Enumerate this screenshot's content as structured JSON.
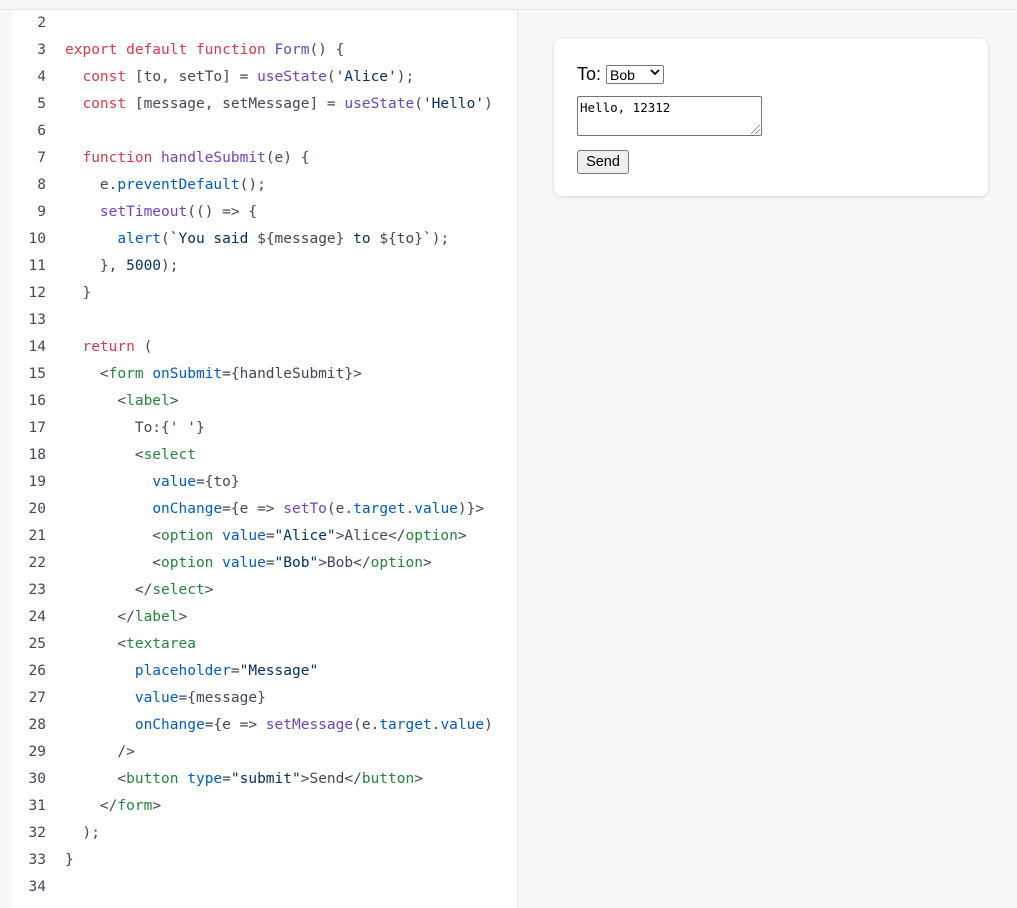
{
  "code": {
    "lines": [
      {
        "n": "2",
        "segs": []
      },
      {
        "n": "3",
        "segs": [
          {
            "c": "kw",
            "t": "export default function "
          },
          {
            "c": "fn",
            "t": "Form"
          },
          {
            "c": "txt",
            "t": "() {"
          }
        ]
      },
      {
        "n": "4",
        "segs": [
          {
            "c": "txt",
            "t": "  "
          },
          {
            "c": "kw",
            "t": "const"
          },
          {
            "c": "txt",
            "t": " [to, setTo] = "
          },
          {
            "c": "fn",
            "t": "useState"
          },
          {
            "c": "txt",
            "t": "("
          },
          {
            "c": "str",
            "t": "'Alice'"
          },
          {
            "c": "txt",
            "t": ");"
          }
        ]
      },
      {
        "n": "5",
        "segs": [
          {
            "c": "txt",
            "t": "  "
          },
          {
            "c": "kw",
            "t": "const"
          },
          {
            "c": "txt",
            "t": " [message, setMessage] = "
          },
          {
            "c": "fn",
            "t": "useState"
          },
          {
            "c": "txt",
            "t": "("
          },
          {
            "c": "str",
            "t": "'Hello'"
          },
          {
            "c": "txt",
            "t": ")"
          }
        ]
      },
      {
        "n": "6",
        "segs": []
      },
      {
        "n": "7",
        "segs": [
          {
            "c": "txt",
            "t": "  "
          },
          {
            "c": "kw",
            "t": "function"
          },
          {
            "c": "txt",
            "t": " "
          },
          {
            "c": "fn",
            "t": "handleSubmit"
          },
          {
            "c": "txt",
            "t": "(e) {"
          }
        ]
      },
      {
        "n": "8",
        "segs": [
          {
            "c": "txt",
            "t": "    e."
          },
          {
            "c": "at",
            "t": "preventDefault"
          },
          {
            "c": "txt",
            "t": "();"
          }
        ]
      },
      {
        "n": "9",
        "segs": [
          {
            "c": "txt",
            "t": "    "
          },
          {
            "c": "fn",
            "t": "setTimeout"
          },
          {
            "c": "txt",
            "t": "(() => {"
          }
        ]
      },
      {
        "n": "10",
        "segs": [
          {
            "c": "txt",
            "t": "      "
          },
          {
            "c": "at",
            "t": "alert"
          },
          {
            "c": "txt",
            "t": "("
          },
          {
            "c": "str",
            "t": "`You said "
          },
          {
            "c": "txt",
            "t": "${message}"
          },
          {
            "c": "str",
            "t": " to "
          },
          {
            "c": "txt",
            "t": "${to}"
          },
          {
            "c": "str",
            "t": "`"
          },
          {
            "c": "txt",
            "t": ");"
          }
        ]
      },
      {
        "n": "11",
        "segs": [
          {
            "c": "txt",
            "t": "    }, "
          },
          {
            "c": "str",
            "t": "5000"
          },
          {
            "c": "txt",
            "t": ");"
          }
        ]
      },
      {
        "n": "12",
        "segs": [
          {
            "c": "txt",
            "t": "  }"
          }
        ]
      },
      {
        "n": "13",
        "segs": []
      },
      {
        "n": "14",
        "segs": [
          {
            "c": "txt",
            "t": "  "
          },
          {
            "c": "kw",
            "t": "return"
          },
          {
            "c": "txt",
            "t": " ("
          }
        ]
      },
      {
        "n": "15",
        "segs": [
          {
            "c": "txt",
            "t": "    <"
          },
          {
            "c": "tag",
            "t": "form"
          },
          {
            "c": "txt",
            "t": " "
          },
          {
            "c": "at",
            "t": "onSubmit"
          },
          {
            "c": "txt",
            "t": "={handleSubmit}>"
          }
        ]
      },
      {
        "n": "16",
        "segs": [
          {
            "c": "txt",
            "t": "      <"
          },
          {
            "c": "tag",
            "t": "label"
          },
          {
            "c": "txt",
            "t": ">"
          }
        ]
      },
      {
        "n": "17",
        "segs": [
          {
            "c": "txt",
            "t": "        To:{' '}"
          }
        ]
      },
      {
        "n": "18",
        "segs": [
          {
            "c": "txt",
            "t": "        <"
          },
          {
            "c": "tag",
            "t": "select"
          }
        ]
      },
      {
        "n": "19",
        "segs": [
          {
            "c": "txt",
            "t": "          "
          },
          {
            "c": "at",
            "t": "value"
          },
          {
            "c": "txt",
            "t": "={to}"
          }
        ]
      },
      {
        "n": "20",
        "segs": [
          {
            "c": "txt",
            "t": "          "
          },
          {
            "c": "at",
            "t": "onChange"
          },
          {
            "c": "txt",
            "t": "={e => "
          },
          {
            "c": "fn",
            "t": "setTo"
          },
          {
            "c": "txt",
            "t": "(e."
          },
          {
            "c": "at",
            "t": "target"
          },
          {
            "c": "txt",
            "t": "."
          },
          {
            "c": "at",
            "t": "value"
          },
          {
            "c": "txt",
            "t": ")}>"
          }
        ]
      },
      {
        "n": "21",
        "segs": [
          {
            "c": "txt",
            "t": "          <"
          },
          {
            "c": "tag",
            "t": "option"
          },
          {
            "c": "txt",
            "t": " "
          },
          {
            "c": "at",
            "t": "value"
          },
          {
            "c": "txt",
            "t": "="
          },
          {
            "c": "str",
            "t": "\"Alice\""
          },
          {
            "c": "txt",
            "t": ">Alice</"
          },
          {
            "c": "tag",
            "t": "option"
          },
          {
            "c": "txt",
            "t": ">"
          }
        ]
      },
      {
        "n": "22",
        "segs": [
          {
            "c": "txt",
            "t": "          <"
          },
          {
            "c": "tag",
            "t": "option"
          },
          {
            "c": "txt",
            "t": " "
          },
          {
            "c": "at",
            "t": "value"
          },
          {
            "c": "txt",
            "t": "="
          },
          {
            "c": "str",
            "t": "\"Bob\""
          },
          {
            "c": "txt",
            "t": ">Bob</"
          },
          {
            "c": "tag",
            "t": "option"
          },
          {
            "c": "txt",
            "t": ">"
          }
        ]
      },
      {
        "n": "23",
        "segs": [
          {
            "c": "txt",
            "t": "        </"
          },
          {
            "c": "tag",
            "t": "select"
          },
          {
            "c": "txt",
            "t": ">"
          }
        ]
      },
      {
        "n": "24",
        "segs": [
          {
            "c": "txt",
            "t": "      </"
          },
          {
            "c": "tag",
            "t": "label"
          },
          {
            "c": "txt",
            "t": ">"
          }
        ]
      },
      {
        "n": "25",
        "segs": [
          {
            "c": "txt",
            "t": "      <"
          },
          {
            "c": "tag",
            "t": "textarea"
          }
        ]
      },
      {
        "n": "26",
        "segs": [
          {
            "c": "txt",
            "t": "        "
          },
          {
            "c": "at",
            "t": "placeholder"
          },
          {
            "c": "txt",
            "t": "="
          },
          {
            "c": "str",
            "t": "\"Message\""
          }
        ]
      },
      {
        "n": "27",
        "segs": [
          {
            "c": "txt",
            "t": "        "
          },
          {
            "c": "at",
            "t": "value"
          },
          {
            "c": "txt",
            "t": "={message}"
          }
        ]
      },
      {
        "n": "28",
        "segs": [
          {
            "c": "txt",
            "t": "        "
          },
          {
            "c": "at",
            "t": "onChange"
          },
          {
            "c": "txt",
            "t": "={e => "
          },
          {
            "c": "fn",
            "t": "setMessage"
          },
          {
            "c": "txt",
            "t": "(e."
          },
          {
            "c": "at",
            "t": "target"
          },
          {
            "c": "txt",
            "t": "."
          },
          {
            "c": "at",
            "t": "value"
          },
          {
            "c": "txt",
            "t": ")"
          }
        ]
      },
      {
        "n": "29",
        "segs": [
          {
            "c": "txt",
            "t": "      />"
          }
        ]
      },
      {
        "n": "30",
        "segs": [
          {
            "c": "txt",
            "t": "      <"
          },
          {
            "c": "tag",
            "t": "button"
          },
          {
            "c": "txt",
            "t": " "
          },
          {
            "c": "at",
            "t": "type"
          },
          {
            "c": "txt",
            "t": "="
          },
          {
            "c": "str",
            "t": "\"submit\""
          },
          {
            "c": "txt",
            "t": ">Send</"
          },
          {
            "c": "tag",
            "t": "button"
          },
          {
            "c": "txt",
            "t": ">"
          }
        ]
      },
      {
        "n": "31",
        "segs": [
          {
            "c": "txt",
            "t": "    </"
          },
          {
            "c": "tag",
            "t": "form"
          },
          {
            "c": "txt",
            "t": ">"
          }
        ]
      },
      {
        "n": "32",
        "segs": [
          {
            "c": "txt",
            "t": "  );"
          }
        ]
      },
      {
        "n": "33",
        "segs": [
          {
            "c": "txt",
            "t": "}"
          }
        ]
      },
      {
        "n": "34",
        "segs": []
      }
    ]
  },
  "preview": {
    "to_label": "To:",
    "select_value": "Bob",
    "textarea_value": "Hello, 12312",
    "send_label": "Send"
  },
  "colors": {
    "keyword": "#d73a49",
    "function": "#6f42c1",
    "tag": "#22863a",
    "attribute": "#005cc5",
    "string": "#032f62",
    "text": "#404756"
  }
}
